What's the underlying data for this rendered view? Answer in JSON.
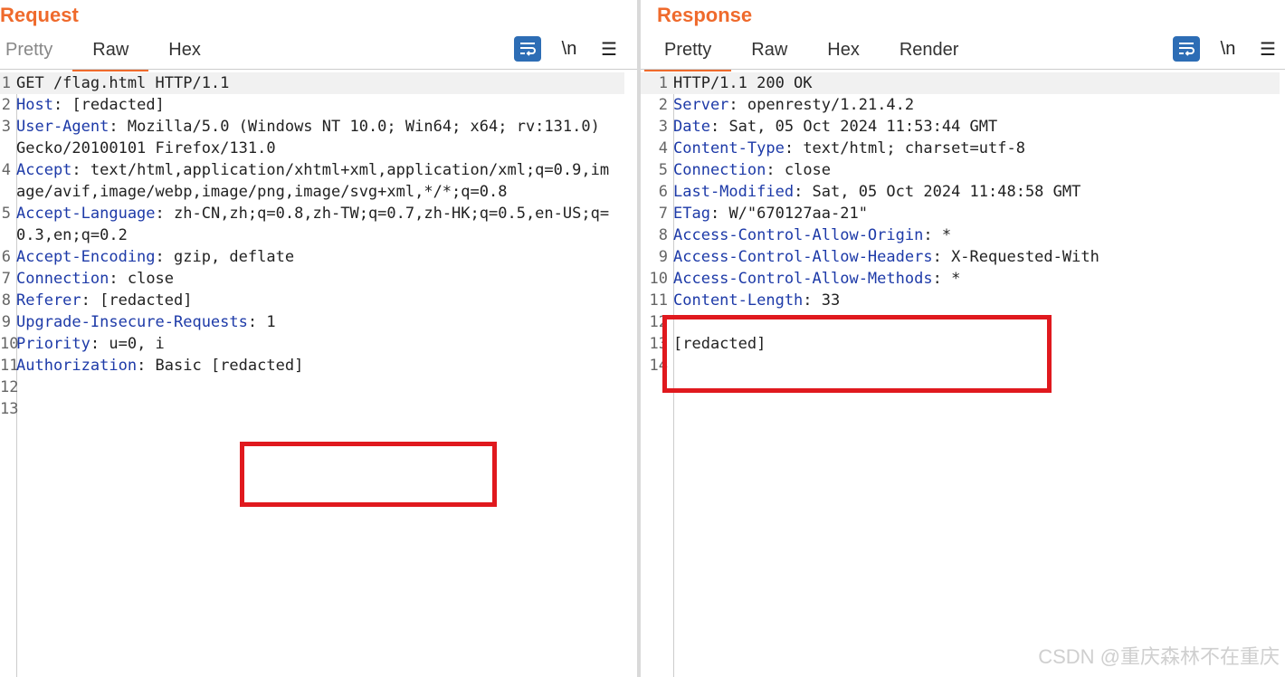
{
  "request": {
    "title": "Request",
    "tabs": [
      "Pretty",
      "Raw",
      "Hex"
    ],
    "tools": {
      "wrap_icon": "wrap-lines-icon",
      "newline_label": "\\n",
      "menu_icon": "hamburger-menu-icon"
    },
    "lines": [
      {
        "n": "1",
        "text": "GET /flag.html HTTP/1.1"
      },
      {
        "n": "2",
        "key": "Host",
        "val": "[redacted]"
      },
      {
        "n": "3",
        "key": "User-Agent",
        "val": "Mozilla/5.0 (Windows NT 10.0; Win64; x64; rv:131.0) Gecko/20100101 Firefox/131.0"
      },
      {
        "n": "4",
        "key": "Accept",
        "val": "text/html,application/xhtml+xml,application/xml;q=0.9,image/avif,image/webp,image/png,image/svg+xml,*/*;q=0.8"
      },
      {
        "n": "5",
        "key": "Accept-Language",
        "val": "zh-CN,zh;q=0.8,zh-TW;q=0.7,zh-HK;q=0.5,en-US;q=0.3,en;q=0.2"
      },
      {
        "n": "6",
        "key": "Accept-Encoding",
        "val": "gzip, deflate"
      },
      {
        "n": "7",
        "key": "Connection",
        "val": "close"
      },
      {
        "n": "8",
        "key": "Referer",
        "val": "[redacted]"
      },
      {
        "n": "9",
        "key": "Upgrade-Insecure-Requests",
        "val": "1"
      },
      {
        "n": "10",
        "key": "Priority",
        "val": "u=0, i"
      },
      {
        "n": "11",
        "key": "Authorization",
        "val": "Basic [redacted]"
      },
      {
        "n": "12",
        "text": ""
      },
      {
        "n": "13",
        "text": ""
      }
    ]
  },
  "response": {
    "title": "Response",
    "tabs": [
      "Pretty",
      "Raw",
      "Hex",
      "Render"
    ],
    "tools": {
      "wrap_icon": "wrap-lines-icon",
      "newline_label": "\\n",
      "menu_icon": "hamburger-menu-icon"
    },
    "lines": [
      {
        "n": "1",
        "text": "HTTP/1.1 200 OK"
      },
      {
        "n": "2",
        "key": "Server",
        "val": "openresty/1.21.4.2"
      },
      {
        "n": "3",
        "key": "Date",
        "val": "Sat, 05 Oct 2024 11:53:44 GMT"
      },
      {
        "n": "4",
        "key": "Content-Type",
        "val": "text/html; charset=utf-8"
      },
      {
        "n": "5",
        "key": "Connection",
        "val": "close"
      },
      {
        "n": "6",
        "key": "Last-Modified",
        "val": "Sat, 05 Oct 2024 11:48:58 GMT"
      },
      {
        "n": "7",
        "key": "ETag",
        "val": "W/\"670127aa-21\""
      },
      {
        "n": "8",
        "key": "Access-Control-Allow-Origin",
        "val": "*"
      },
      {
        "n": "9",
        "key": "Access-Control-Allow-Headers",
        "val": "X-Requested-With"
      },
      {
        "n": "10",
        "key": "Access-Control-Allow-Methods",
        "val": "*"
      },
      {
        "n": "11",
        "key": "Content-Length",
        "val": "33"
      },
      {
        "n": "12",
        "text": ""
      },
      {
        "n": "13",
        "text": "[redacted]"
      },
      {
        "n": "14",
        "text": ""
      }
    ]
  },
  "watermark": "CSDN @重庆森林不在重庆",
  "colors": {
    "accent": "#ef6a2c",
    "header_key": "#1d3aa8",
    "highlight_box": "#e0191e"
  }
}
